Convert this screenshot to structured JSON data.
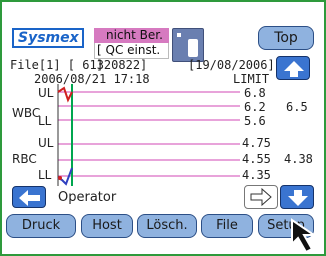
{
  "header": {
    "logo_text": "Sysmex",
    "status_line1": "nicht Ber.",
    "status_line2": "[ QC einst. ]",
    "top_label": "Top"
  },
  "info": {
    "file_line": "File[1] [   61320822]",
    "file_date": "[19/08/2006]",
    "datetime": "2006/08/21   17:18",
    "limit_label": "LIMIT"
  },
  "params": [
    {
      "name": "WBC",
      "ul": "UL",
      "ll": "LL",
      "upper": "6.8",
      "mid": "6.2",
      "lower": "5.6",
      "value": "6.5"
    },
    {
      "name": "RBC",
      "ul": "UL",
      "ll": "LL",
      "upper": "4.75",
      "mid": "4.55",
      "lower": "4.35",
      "value": "4.38"
    }
  ],
  "footer": {
    "operator_label": "Operator",
    "buttons": [
      "Druck",
      "Host",
      "Lösch.",
      "File",
      "Setup"
    ]
  },
  "colors": {
    "frame": "#2e9a3c",
    "status_bg": "#d67ac0",
    "button_bg": "#8fb2df",
    "arrow_bg": "#3a74d0",
    "limit_line": "#d047b6",
    "cursor_line": "#00a64f"
  },
  "icons": {
    "printer": "printer-icon",
    "up": "arrow-up-icon",
    "down": "arrow-down-icon",
    "left": "arrow-left-icon",
    "right": "arrow-right-icon",
    "cursor": "mouse-pointer-icon"
  }
}
